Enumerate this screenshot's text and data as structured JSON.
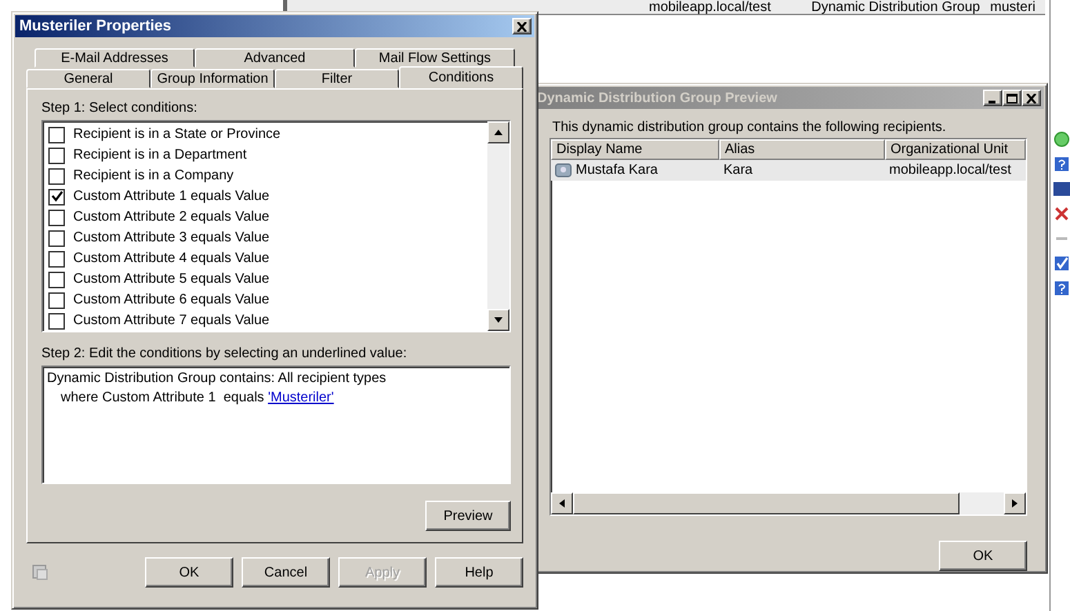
{
  "background_list": {
    "row": {
      "column_1": "mobileapp.local/test",
      "column_2": "Dynamic Distribution Group",
      "column_3": "musteri"
    }
  },
  "properties_dialog": {
    "title": "Musteriler Properties",
    "tab_rows": [
      [
        {
          "label": "E-Mail Addresses",
          "selected": false
        },
        {
          "label": "Advanced",
          "selected": false
        },
        {
          "label": "Mail Flow Settings",
          "selected": false
        }
      ],
      [
        {
          "label": "General",
          "selected": false
        },
        {
          "label": "Group Information",
          "selected": false
        },
        {
          "label": "Filter",
          "selected": false
        },
        {
          "label": "Conditions",
          "selected": true
        }
      ]
    ],
    "step1_label": "Step 1: Select conditions:",
    "conditions": [
      {
        "label": "Recipient is in a State or Province",
        "checked": false
      },
      {
        "label": "Recipient is in a Department",
        "checked": false
      },
      {
        "label": "Recipient is in a Company",
        "checked": false
      },
      {
        "label": "Custom Attribute 1 equals Value",
        "checked": true
      },
      {
        "label": "Custom Attribute 2 equals Value",
        "checked": false
      },
      {
        "label": "Custom Attribute 3 equals Value",
        "checked": false
      },
      {
        "label": "Custom Attribute 4 equals Value",
        "checked": false
      },
      {
        "label": "Custom Attribute 5 equals Value",
        "checked": false
      },
      {
        "label": "Custom Attribute 6 equals Value",
        "checked": false
      },
      {
        "label": "Custom Attribute 7 equals Value",
        "checked": false
      }
    ],
    "step2_label": "Step 2: Edit the conditions by selecting an underlined value:",
    "description_lines": [
      "Dynamic Distribution Group contains: All recipient types",
      "where Custom Attribute 1  equals "
    ],
    "description_link": "'Musteriler'",
    "preview_button": "Preview",
    "buttons": [
      {
        "label": "OK",
        "disabled": false
      },
      {
        "label": "Cancel",
        "disabled": false
      },
      {
        "label": "Apply",
        "disabled": true
      },
      {
        "label": "Help",
        "disabled": false
      }
    ]
  },
  "preview_window": {
    "title": "Dynamic Distribution Group Preview",
    "intro": "This dynamic distribution group contains the following recipients.",
    "columns": [
      "Display Name",
      "Alias",
      "Organizational Unit"
    ],
    "rows": [
      {
        "cells": [
          "Mustafa Kara",
          "Kara",
          "mobileapp.local/test"
        ]
      }
    ],
    "ok_button": "OK"
  }
}
